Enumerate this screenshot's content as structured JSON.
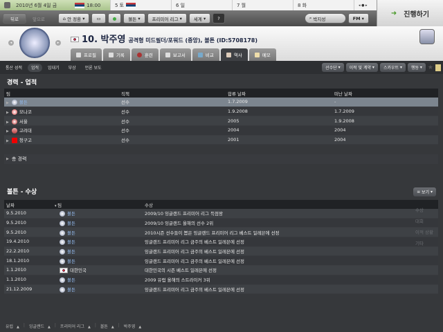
{
  "datebar": {
    "current": "2010년 6월 4일 금",
    "time": "18:00",
    "days": [
      "5 토",
      "6 일",
      "7 월",
      "8 화"
    ]
  },
  "nav": {
    "back": "뒤로",
    "forward": "앞으로",
    "home": "안 정환",
    "club": "볼튼",
    "league": "프리미어 리그",
    "world": "세계",
    "help": "?",
    "search": "박지성",
    "fm": "FM",
    "proceed": "진행하기"
  },
  "player": {
    "number_name": "10. 박주영",
    "desc": "공격형 미드필더/포워드 (중앙), 볼튼 (ID:5708178)"
  },
  "tabs": [
    "프로필",
    "기록",
    "훈련",
    "보고서",
    "비교",
    "역사",
    "메모"
  ],
  "subnav": {
    "items": [
      "통산 성적",
      "업적",
      "임대기",
      "부상",
      "언론 보도"
    ],
    "right": [
      "선수단",
      "이적 및 계약",
      "스카우트",
      "행동"
    ]
  },
  "career": {
    "title": "경력 - 업적",
    "headers": [
      "팀",
      "직책",
      "합류 날짜",
      "떠난 날짜"
    ],
    "rows": [
      [
        "볼튼",
        "선수",
        "1.7.2009",
        "-"
      ],
      [
        "모나코",
        "선수",
        "1.9.2008",
        "1.7.2009"
      ],
      [
        "서울",
        "선수",
        "2005",
        "1.9.2008"
      ],
      [
        "고려대",
        "선수",
        "2004",
        "2004"
      ],
      [
        "청구고",
        "선수",
        "2001",
        "2004"
      ]
    ],
    "total": "총 경력"
  },
  "awards": {
    "title": "볼튼 - 수상",
    "view": "보기",
    "headers": [
      "날짜",
      "팀",
      "수상"
    ],
    "rows": [
      [
        "9.5.2010",
        "볼튼",
        "2009/10 잉글랜드 프리미어 리그 득점왕"
      ],
      [
        "9.5.2010",
        "볼튼",
        "2009/10 잉글랜드 올해의 선수 2위"
      ],
      [
        "9.5.2010",
        "볼튼",
        "2010시즌 선수들이 뽑은 잉글랜드 프리미어 리그 베스트 일레븐에 선정"
      ],
      [
        "19.4.2010",
        "볼튼",
        "잉글랜드 프리미어 리그 금주의 베스트 일레븐에 선정"
      ],
      [
        "22.2.2010",
        "볼튼",
        "잉글랜드 프리미어 리그 금주의 베스트 일레븐에 선정"
      ],
      [
        "18.1.2010",
        "볼튼",
        "잉글랜드 프리미어 리그 금주의 베스트 일레븐에 선정"
      ],
      [
        "1.1.2010",
        "대한민국",
        "대한민국의 시즌 베스트 일레븐에 선정"
      ],
      [
        "1.1.2010",
        "볼튼",
        "2009 유럽 올해의 스트라이커 3위"
      ],
      [
        "21.12.2009",
        "볼튼",
        "잉글랜드 프리미어 리그 금주의 베스트 일레븐에 선정"
      ]
    ],
    "view_options": [
      "수상",
      "대회",
      "이적 상황",
      "기타"
    ]
  },
  "footer": [
    "유럽",
    "잉글랜드",
    "프리미어 리그",
    "볼튼",
    "박주영"
  ]
}
